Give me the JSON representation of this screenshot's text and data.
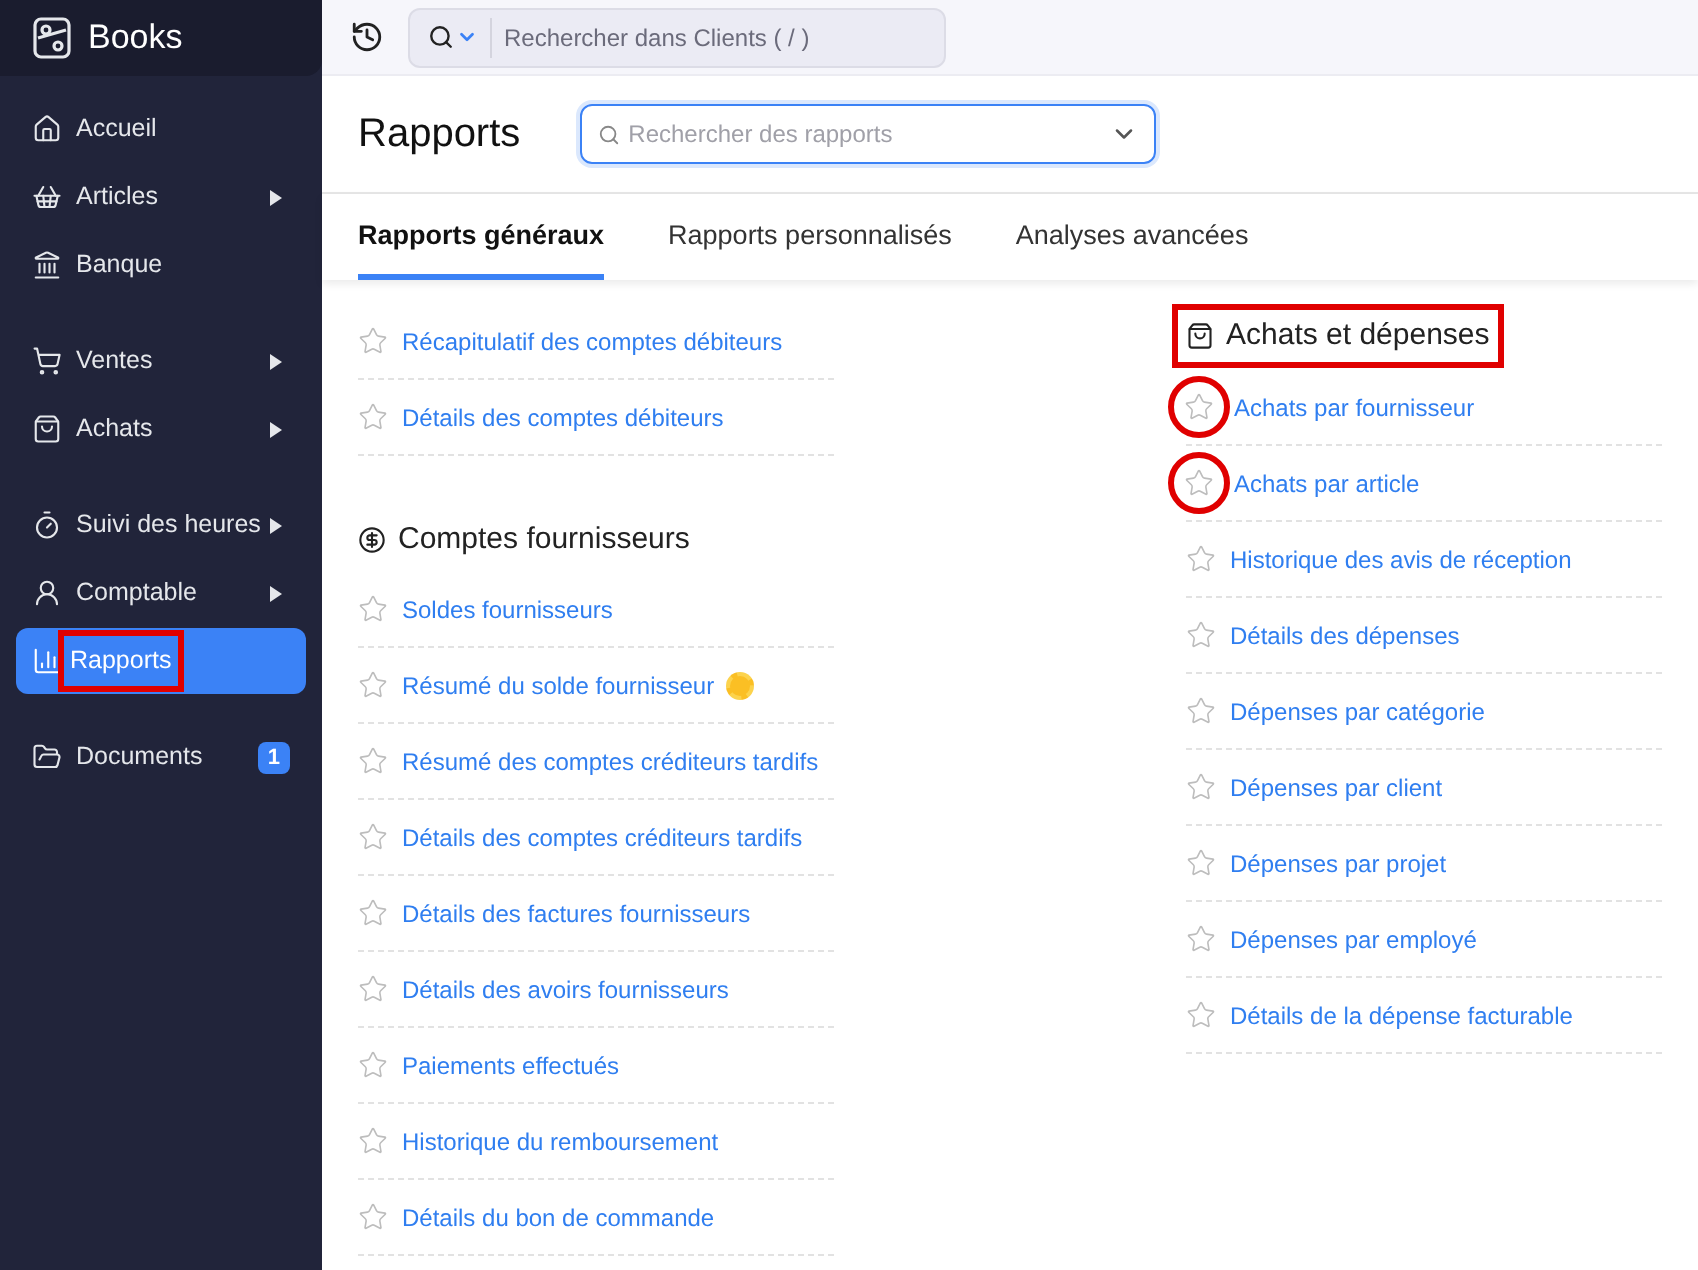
{
  "app": {
    "name": "Books"
  },
  "sidebar": {
    "groups": [
      {
        "items": [
          {
            "label": "Accueil",
            "submenu": false,
            "selected": false,
            "annotated": false
          },
          {
            "label": "Articles",
            "submenu": true,
            "selected": false,
            "annotated": false
          },
          {
            "label": "Banque",
            "submenu": false,
            "selected": false,
            "annotated": false
          }
        ]
      },
      {
        "items": [
          {
            "label": "Ventes",
            "submenu": true,
            "selected": false,
            "annotated": false
          },
          {
            "label": "Achats",
            "submenu": true,
            "selected": false,
            "annotated": false
          }
        ]
      },
      {
        "items": [
          {
            "label": "Suivi des heures",
            "submenu": true,
            "selected": false,
            "annotated": false
          },
          {
            "label": "Comptable",
            "submenu": true,
            "selected": false,
            "annotated": false
          },
          {
            "label": "Rapports",
            "submenu": false,
            "selected": true,
            "annotated": true
          }
        ]
      },
      {
        "items": [
          {
            "label": "Documents",
            "submenu": false,
            "selected": false,
            "annotated": false,
            "badge": "1"
          }
        ]
      }
    ]
  },
  "topbar": {
    "search_placeholder": "Rechercher dans Clients ( / )"
  },
  "header": {
    "title": "Rapports",
    "search_placeholder": "Rechercher des rapports"
  },
  "tabs": [
    {
      "label": "Rapports généraux",
      "selected": true
    },
    {
      "label": "Rapports personnalisés",
      "selected": false
    },
    {
      "label": "Analyses avancées",
      "selected": false
    }
  ],
  "columns": [
    {
      "sections": [
        {
          "reports": [
            {
              "label": "Récapitulatif des comptes débiteurs",
              "new": false,
              "annotated": false
            },
            {
              "label": "Détails des comptes débiteurs",
              "new": false,
              "annotated": false
            }
          ]
        },
        {
          "title": "Comptes fournisseurs",
          "annotated": false,
          "reports": [
            {
              "label": "Soldes fournisseurs",
              "new": false,
              "annotated": false
            },
            {
              "label": "Résumé du solde fournisseur",
              "new": true,
              "annotated": false
            },
            {
              "label": "Résumé des comptes créditeurs tardifs",
              "new": false,
              "annotated": false
            },
            {
              "label": "Détails des comptes créditeurs tardifs",
              "new": false,
              "annotated": false
            },
            {
              "label": "Détails des factures fournisseurs",
              "new": false,
              "annotated": false
            },
            {
              "label": "Détails des avoirs fournisseurs",
              "new": false,
              "annotated": false
            },
            {
              "label": "Paiements effectués",
              "new": false,
              "annotated": false
            },
            {
              "label": "Historique du remboursement",
              "new": false,
              "annotated": false
            },
            {
              "label": "Détails du bon de commande",
              "new": false,
              "annotated": false
            }
          ]
        }
      ]
    },
    {
      "sections": [
        {
          "title": "Achats et dépenses",
          "annotated": true,
          "reports": [
            {
              "label": "Achats par fournisseur",
              "new": false,
              "annotated": true
            },
            {
              "label": "Achats par article",
              "new": false,
              "annotated": true
            },
            {
              "label": "Historique des avis de réception",
              "new": false,
              "annotated": false
            },
            {
              "label": "Détails des dépenses",
              "new": false,
              "annotated": false
            },
            {
              "label": "Dépenses par catégorie",
              "new": false,
              "annotated": false
            },
            {
              "label": "Dépenses par client",
              "new": false,
              "annotated": false
            },
            {
              "label": "Dépenses par projet",
              "new": false,
              "annotated": false
            },
            {
              "label": "Dépenses par employé",
              "new": false,
              "annotated": false
            },
            {
              "label": "Détails de la dépense facturable",
              "new": false,
              "annotated": false
            }
          ]
        }
      ]
    }
  ]
}
